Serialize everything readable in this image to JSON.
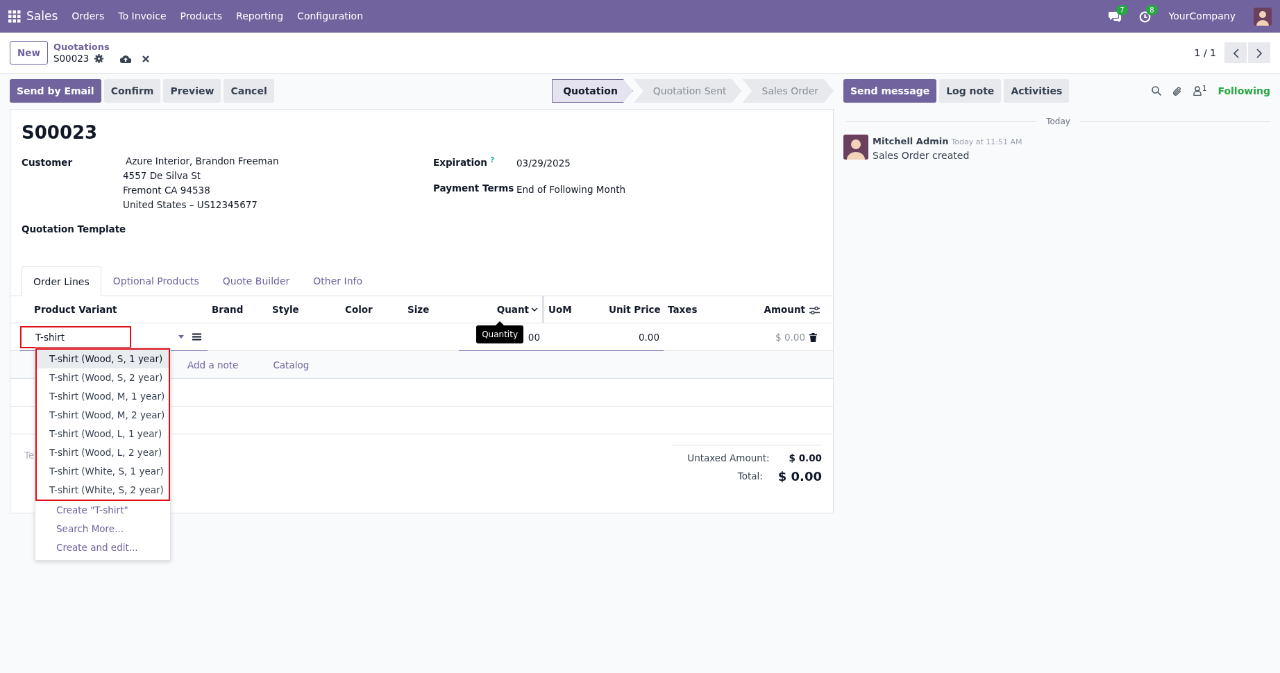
{
  "navbar": {
    "app": "Sales",
    "menu": [
      "Orders",
      "To Invoice",
      "Products",
      "Reporting",
      "Configuration"
    ],
    "messages_badge": "7",
    "activities_badge": "8",
    "company": "YourCompany"
  },
  "control_panel": {
    "new_button": "New",
    "breadcrumb": "Quotations",
    "record": "S00023",
    "pager": "1 / 1"
  },
  "actions": [
    {
      "label": "Send by Email",
      "primary": true
    },
    {
      "label": "Confirm",
      "primary": false
    },
    {
      "label": "Preview",
      "primary": false
    },
    {
      "label": "Cancel",
      "primary": false
    }
  ],
  "statusbar": [
    {
      "label": "Quotation",
      "selected": true
    },
    {
      "label": "Quotation Sent",
      "selected": false
    },
    {
      "label": "Sales Order",
      "selected": false
    }
  ],
  "form": {
    "title": "S00023",
    "customer_label": "Customer",
    "customer_name": "Azure Interior, Brandon Freeman",
    "address": [
      "4557 De Silva St",
      "Fremont CA 94538",
      "United States – US12345677"
    ],
    "template_label": "Quotation Template",
    "expiration_label": "Expiration",
    "help_mark": "?",
    "expiration": "03/29/2025",
    "terms_label": "Payment Terms",
    "terms": "End of Following Month"
  },
  "tabs": [
    {
      "label": "Order Lines",
      "selected": true
    },
    {
      "label": "Optional Products",
      "selected": false
    },
    {
      "label": "Quote Builder",
      "selected": false
    },
    {
      "label": "Other Info",
      "selected": false
    }
  ],
  "table": {
    "columns": [
      {
        "label": "Product Variant"
      },
      {
        "label": "Brand"
      },
      {
        "label": "Style"
      },
      {
        "label": "Color"
      },
      {
        "label": "Size"
      },
      {
        "label": "Quant"
      },
      {
        "label": "UoM"
      },
      {
        "label": "Unit Price"
      },
      {
        "label": "Taxes"
      },
      {
        "label": "Amount"
      }
    ],
    "row": {
      "product": "T-shirt",
      "highlighted": true,
      "quantity": "00",
      "unit_price": "0.00",
      "amount": "$ 0.00"
    },
    "tooltip": "Quantity",
    "add_links": [
      "Add a note",
      "Catalog"
    ]
  },
  "notes_placeholder": "Te",
  "totals": {
    "untaxed_label": "Untaxed Amount:",
    "untaxed": "$ 0.00",
    "total_label": "Total:",
    "total": "$ 0.00"
  },
  "dropdown": {
    "highlighted": true,
    "options": [
      {
        "label": "T-shirt (Wood, S, 1 year)",
        "selected": true
      },
      {
        "label": "T-shirt (Wood, S, 2 year)",
        "selected": false
      },
      {
        "label": "T-shirt (Wood, M, 1 year)",
        "selected": false
      },
      {
        "label": "T-shirt (Wood, M, 2 year)",
        "selected": false
      },
      {
        "label": "T-shirt (Wood, L, 1 year)",
        "selected": false
      },
      {
        "label": "T-shirt (Wood, L, 2 year)",
        "selected": false
      },
      {
        "label": "T-shirt (White, S, 1 year)",
        "selected": false
      },
      {
        "label": "T-shirt (White, S, 2 year)",
        "selected": false
      }
    ],
    "actions": [
      "Create \"T-shirt\"",
      "Search More...",
      "Create and edit..."
    ]
  },
  "chatter": {
    "buttons": [
      {
        "label": "Send message",
        "primary": true
      },
      {
        "label": "Log note",
        "primary": false
      },
      {
        "label": "Activities",
        "primary": false
      }
    ],
    "followers_count": "1",
    "follow": "Following",
    "divider": "Today",
    "messages": [
      {
        "author": "Mitchell Admin",
        "time": "Today at 11:51 AM",
        "body": "Sales Order created"
      }
    ]
  }
}
